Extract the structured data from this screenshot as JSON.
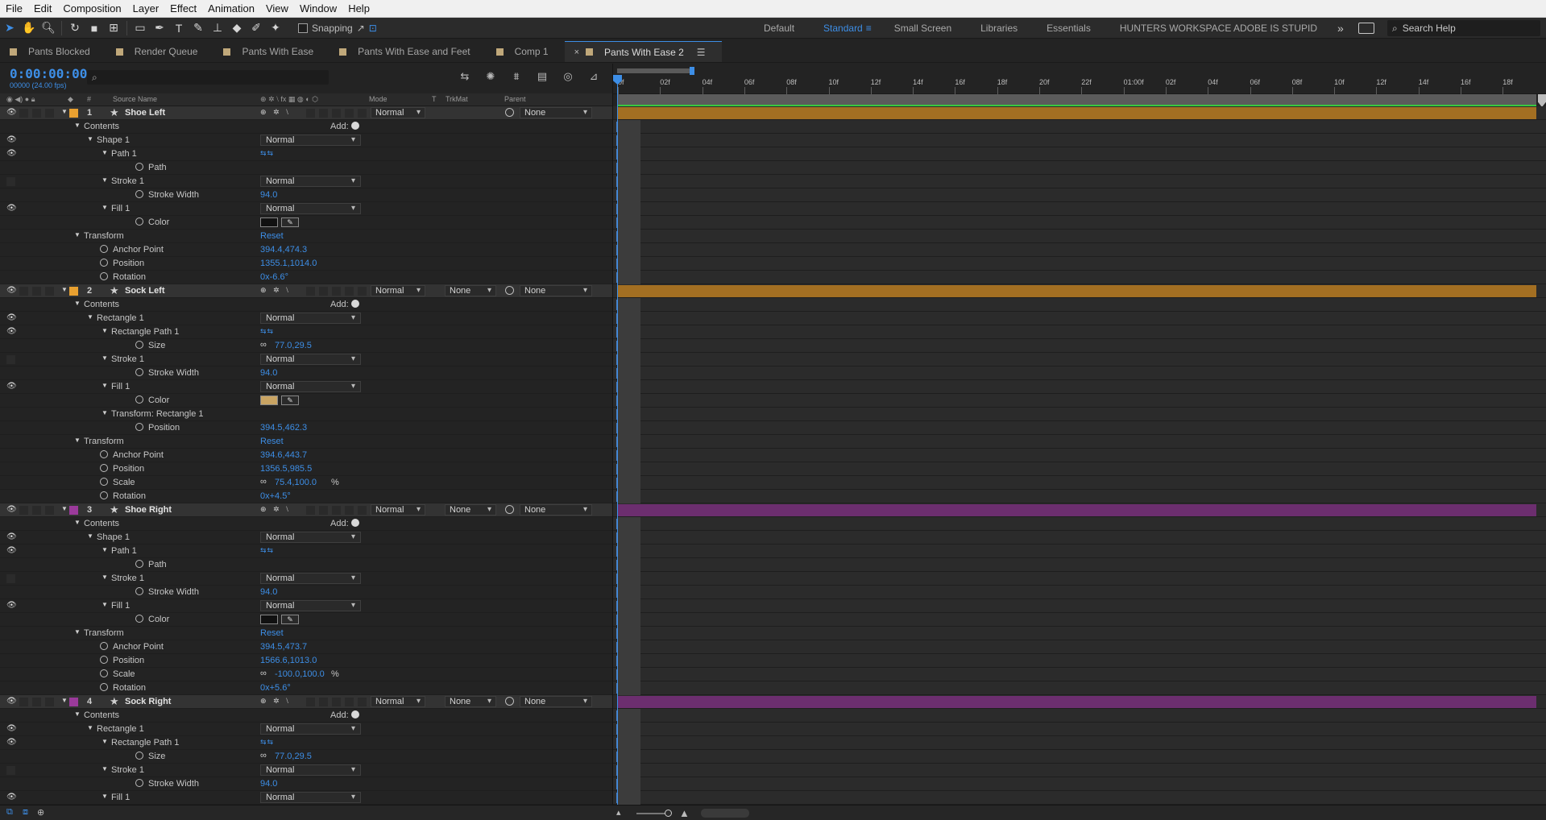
{
  "menu": [
    "File",
    "Edit",
    "Composition",
    "Layer",
    "Effect",
    "Animation",
    "View",
    "Window",
    "Help"
  ],
  "toolbar": {
    "snapping_label": "Snapping",
    "workspaces": [
      "Default",
      "Standard",
      "Small Screen",
      "Libraries",
      "Essentials",
      "HUNTERS WORKSPACE ADOBE IS STUPID"
    ],
    "active_workspace": "Standard",
    "search_placeholder": "Search Help",
    "overflow": "»"
  },
  "tabs": [
    "Pants Blocked",
    "Render Queue",
    "Pants With Ease",
    "Pants With Ease and Feet",
    "Comp 1",
    "Pants With Ease 2"
  ],
  "active_tab": "Pants With Ease 2",
  "timecode": "0:00:00:00",
  "fps": "00000 (24.00 fps)",
  "search_field": "",
  "columns": {
    "source_name": "Source Name",
    "mode": "Mode",
    "trkmat_t": "T",
    "trkmat": "TrkMat",
    "parent": "Parent",
    "hash": "#"
  },
  "ruler": [
    "0f",
    "02f",
    "04f",
    "06f",
    "08f",
    "10f",
    "12f",
    "14f",
    "16f",
    "18f",
    "20f",
    "22f",
    "01:00f",
    "02f",
    "04f",
    "06f",
    "08f",
    "10f",
    "12f",
    "14f",
    "16f",
    "18f"
  ],
  "labels": {
    "contents": "Contents",
    "add": "Add:",
    "transform": "Transform",
    "reset": "Reset",
    "normal": "Normal",
    "none": "None",
    "path": "Path",
    "stroke_width": "Stroke Width",
    "color": "Color",
    "anchor_point": "Anchor Point",
    "position": "Position",
    "rotation": "Rotation",
    "scale": "Scale",
    "size": "Size"
  },
  "layers": [
    {
      "num": "1",
      "name": "Shoe Left",
      "label_color": "#e8a030",
      "bar_color": "#a36f22"
    },
    {
      "num": "2",
      "name": "Sock Left",
      "label_color": "#e8a030",
      "bar_color": "#a36f22"
    },
    {
      "num": "3",
      "name": "Shoe Right",
      "label_color": "#9a3a9a",
      "bar_color": "#6c2e6f"
    },
    {
      "num": "4",
      "name": "Sock Right",
      "label_color": "#9a3a9a",
      "bar_color": "#6c2e6f"
    }
  ],
  "rows": [
    {
      "type": "layer",
      "layer": 0,
      "eye": true
    },
    {
      "type": "contents",
      "indent": 1,
      "eye": false
    },
    {
      "type": "group",
      "indent": 2,
      "label": "Shape 1",
      "mode": "Normal",
      "eye": true
    },
    {
      "type": "group",
      "indent": 3,
      "label": "Path 1",
      "pathbtn": true,
      "eye": true
    },
    {
      "type": "prop",
      "indent": 4,
      "label": "Path",
      "eye": false
    },
    {
      "type": "group",
      "indent": 3,
      "label": "Stroke 1",
      "mode": "Normal",
      "eye": "box"
    },
    {
      "type": "prop",
      "indent": 4,
      "label": "Stroke Width",
      "value": "94.0",
      "eye": false
    },
    {
      "type": "group",
      "indent": 3,
      "label": "Fill 1",
      "mode": "Normal",
      "eye": true
    },
    {
      "type": "prop",
      "indent": 4,
      "label": "Color",
      "color": "#111111",
      "eye": false
    },
    {
      "type": "transform",
      "indent": 1,
      "label": "Transform",
      "eye": false
    },
    {
      "type": "prop",
      "indent": 2,
      "label": "Anchor Point",
      "value": "394.4,474.3",
      "eye": false
    },
    {
      "type": "prop",
      "indent": 2,
      "label": "Position",
      "value": "1355.1,1014.0",
      "eye": false
    },
    {
      "type": "prop",
      "indent": 2,
      "label": "Rotation",
      "value": "0x-6.6°",
      "eye": false
    },
    {
      "type": "layer",
      "layer": 1,
      "eye": true
    },
    {
      "type": "contents",
      "indent": 1,
      "eye": false
    },
    {
      "type": "group",
      "indent": 2,
      "label": "Rectangle 1",
      "mode": "Normal",
      "eye": true
    },
    {
      "type": "group",
      "indent": 3,
      "label": "Rectangle Path 1",
      "pathbtn": true,
      "eye": true
    },
    {
      "type": "prop",
      "indent": 4,
      "label": "Size",
      "value": "77.0,29.5",
      "chain": true,
      "eye": false
    },
    {
      "type": "group",
      "indent": 3,
      "label": "Stroke 1",
      "mode": "Normal",
      "eye": "box"
    },
    {
      "type": "prop",
      "indent": 4,
      "label": "Stroke Width",
      "value": "94.0",
      "eye": false
    },
    {
      "type": "group",
      "indent": 3,
      "label": "Fill 1",
      "mode": "Normal",
      "eye": true
    },
    {
      "type": "prop",
      "indent": 4,
      "label": "Color",
      "color": "#c9a463",
      "eye": false
    },
    {
      "type": "group",
      "indent": 3,
      "label": "Transform: Rectangle 1",
      "eye": false
    },
    {
      "type": "prop",
      "indent": 4,
      "label": "Position",
      "value": "394.5,462.3",
      "eye": false
    },
    {
      "type": "transform",
      "indent": 1,
      "label": "Transform",
      "eye": false
    },
    {
      "type": "prop",
      "indent": 2,
      "label": "Anchor Point",
      "value": "394.6,443.7",
      "eye": false
    },
    {
      "type": "prop",
      "indent": 2,
      "label": "Position",
      "value": "1356.5,985.5",
      "eye": false
    },
    {
      "type": "prop",
      "indent": 2,
      "label": "Scale",
      "value": "75.4,100.0",
      "suffix": "%",
      "chain": true,
      "eye": false
    },
    {
      "type": "prop",
      "indent": 2,
      "label": "Rotation",
      "value": "0x+4.5°",
      "eye": false
    },
    {
      "type": "layer",
      "layer": 2,
      "eye": true
    },
    {
      "type": "contents",
      "indent": 1,
      "eye": false
    },
    {
      "type": "group",
      "indent": 2,
      "label": "Shape 1",
      "mode": "Normal",
      "eye": true
    },
    {
      "type": "group",
      "indent": 3,
      "label": "Path 1",
      "pathbtn": true,
      "eye": true
    },
    {
      "type": "prop",
      "indent": 4,
      "label": "Path",
      "eye": false
    },
    {
      "type": "group",
      "indent": 3,
      "label": "Stroke 1",
      "mode": "Normal",
      "eye": "box"
    },
    {
      "type": "prop",
      "indent": 4,
      "label": "Stroke Width",
      "value": "94.0",
      "eye": false
    },
    {
      "type": "group",
      "indent": 3,
      "label": "Fill 1",
      "mode": "Normal",
      "eye": true
    },
    {
      "type": "prop",
      "indent": 4,
      "label": "Color",
      "color": "#111111",
      "eye": false
    },
    {
      "type": "transform",
      "indent": 1,
      "label": "Transform",
      "eye": false
    },
    {
      "type": "prop",
      "indent": 2,
      "label": "Anchor Point",
      "value": "394.5,473.7",
      "eye": false
    },
    {
      "type": "prop",
      "indent": 2,
      "label": "Position",
      "value": "1566.6,1013.0",
      "eye": false
    },
    {
      "type": "prop",
      "indent": 2,
      "label": "Scale",
      "value": "-100.0,100.0",
      "suffix": "%",
      "chain": true,
      "eye": false
    },
    {
      "type": "prop",
      "indent": 2,
      "label": "Rotation",
      "value": "0x+5.6°",
      "eye": false
    },
    {
      "type": "layer",
      "layer": 3,
      "eye": true
    },
    {
      "type": "contents",
      "indent": 1,
      "eye": false
    },
    {
      "type": "group",
      "indent": 2,
      "label": "Rectangle 1",
      "mode": "Normal",
      "eye": true
    },
    {
      "type": "group",
      "indent": 3,
      "label": "Rectangle Path 1",
      "pathbtn": true,
      "eye": true
    },
    {
      "type": "prop",
      "indent": 4,
      "label": "Size",
      "value": "77.0,29.5",
      "chain": true,
      "eye": false
    },
    {
      "type": "group",
      "indent": 3,
      "label": "Stroke 1",
      "mode": "Normal",
      "eye": "box"
    },
    {
      "type": "prop",
      "indent": 4,
      "label": "Stroke Width",
      "value": "94.0",
      "eye": false
    },
    {
      "type": "group",
      "indent": 3,
      "label": "Fill 1",
      "mode": "Normal",
      "eye": true
    }
  ],
  "colors": {
    "accent": "#3d8ee6",
    "green": "#39c83f"
  }
}
